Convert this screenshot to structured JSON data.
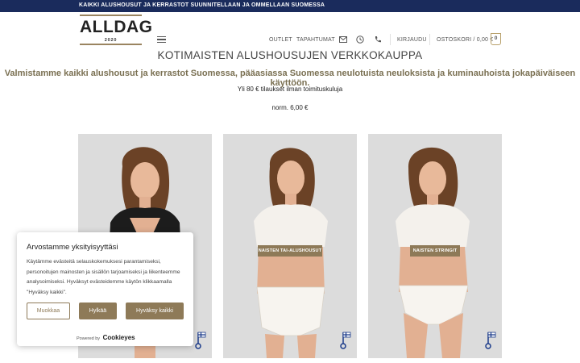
{
  "topbar": {
    "text": "KAIKKI ALUSHOUSUT JA KERRASTOT SUUNNITELLAAN JA OMMELLAAN SUOMESSA"
  },
  "header": {
    "logo": {
      "name": "ALLDAG",
      "year": "2020"
    },
    "nav": {
      "outlet": "OUTLET",
      "events": "TAPAHTUMAT",
      "login": "KIRJAUDU",
      "cart": "OSTOSKORI / 0,00 €",
      "cart_count": "0"
    },
    "icons": [
      "menu-icon",
      "mail-icon",
      "clock-icon",
      "phone-icon"
    ]
  },
  "hero": {
    "title": "KOTIMAISTEN ALUSHOUSUJEN VERKKOKAUPPA",
    "subtitle": "Valmistamme kaikki alushousut ja kerrastot Suomessa, pääasiassa Suomessa neulotuista neuloksista ja kuminauhoista jokapäiväiseen käyttöön.",
    "shipping": "Yli 80 € tilaukset ilman toimituskuluja",
    "price": "norm. 6,00 €"
  },
  "products": [
    {
      "badge": ""
    },
    {
      "badge": "NAISTEN TAI-ALUSHOUSUT"
    },
    {
      "badge": "NAISTEN STRINGIT"
    }
  ],
  "cookie": {
    "title": "Arvostamme yksityisyyttäsi",
    "text": "Käytämme evästeitä selauskokemuksesi parantamiseksi, personoitujen mainosten ja sisällön tarjoamiseksi ja liikenteemme analysoimiseksi. Hyväksyt evästeidemme käytön klikkaamalla \"Hyväksy kaikki\".",
    "customize": "Muokkaa",
    "reject": "Hylkää",
    "accept": "Hyväksy kaikki",
    "powered_by": "Powered by",
    "brand": "Cookieyes"
  },
  "colors": {
    "topbar": "#1a2b5c",
    "accent": "#8e7a58",
    "subtitle": "#7a7052"
  }
}
